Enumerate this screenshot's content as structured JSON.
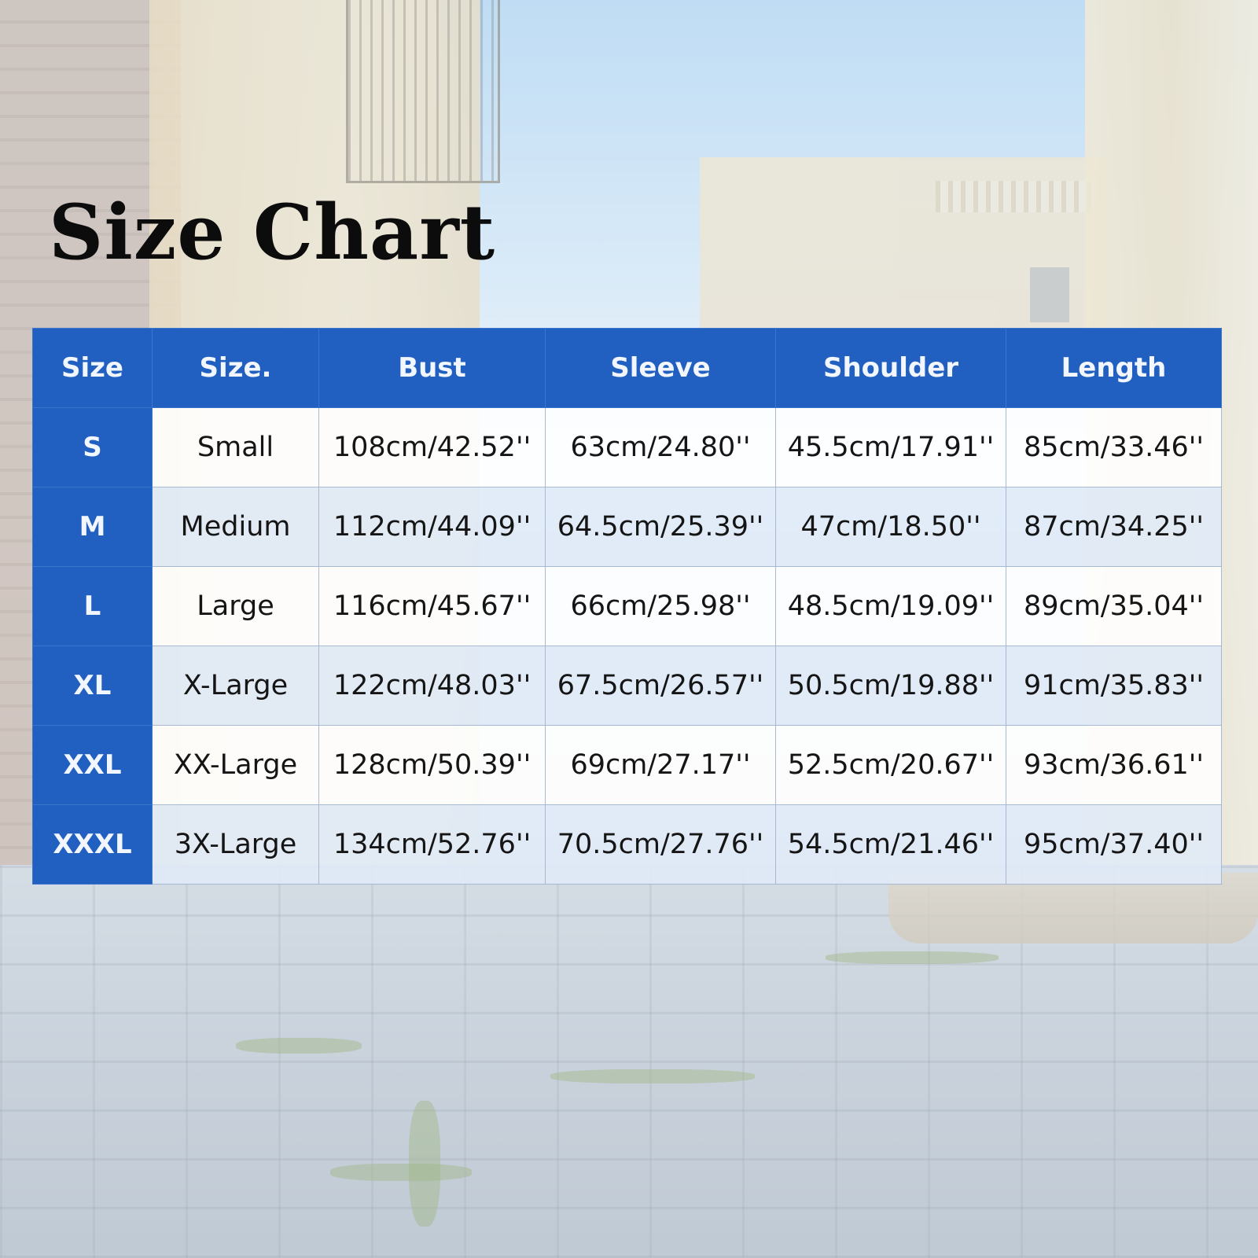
{
  "title": "Size Chart",
  "colors": {
    "header_blue": "#2160c0",
    "row_light": "#ffffff",
    "row_tint": "#e0ebf8",
    "title": "#0c0c0c"
  },
  "table": {
    "headers": [
      "Size",
      "Size.",
      "Bust",
      "Sleeve",
      "Shoulder",
      "Length"
    ],
    "rows": [
      {
        "size": "S",
        "name": "Small",
        "bust": "108cm/42.52''",
        "sleeve": "63cm/24.80''",
        "shoulder": "45.5cm/17.91''",
        "length": "85cm/33.46''"
      },
      {
        "size": "M",
        "name": "Medium",
        "bust": "112cm/44.09''",
        "sleeve": "64.5cm/25.39''",
        "shoulder": "47cm/18.50''",
        "length": "87cm/34.25''"
      },
      {
        "size": "L",
        "name": "Large",
        "bust": "116cm/45.67''",
        "sleeve": "66cm/25.98''",
        "shoulder": "48.5cm/19.09''",
        "length": "89cm/35.04''"
      },
      {
        "size": "XL",
        "name": "X-Large",
        "bust": "122cm/48.03''",
        "sleeve": "67.5cm/26.57''",
        "shoulder": "50.5cm/19.88''",
        "length": "91cm/35.83''"
      },
      {
        "size": "XXL",
        "name": "XX-Large",
        "bust": "128cm/50.39''",
        "sleeve": "69cm/27.17''",
        "shoulder": "52.5cm/20.67''",
        "length": "93cm/36.61''"
      },
      {
        "size": "XXXL",
        "name": "3X-Large",
        "bust": "134cm/52.76''",
        "sleeve": "70.5cm/27.76''",
        "shoulder": "54.5cm/21.46''",
        "length": "95cm/37.40''"
      }
    ]
  }
}
